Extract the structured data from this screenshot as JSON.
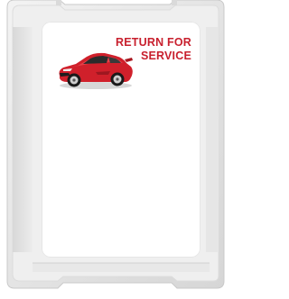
{
  "tag": {
    "title_line1": "RETURN FOR",
    "title_line2": "SERVICE",
    "title_color": "#c8202e",
    "image": "red-sports-car-icon"
  }
}
